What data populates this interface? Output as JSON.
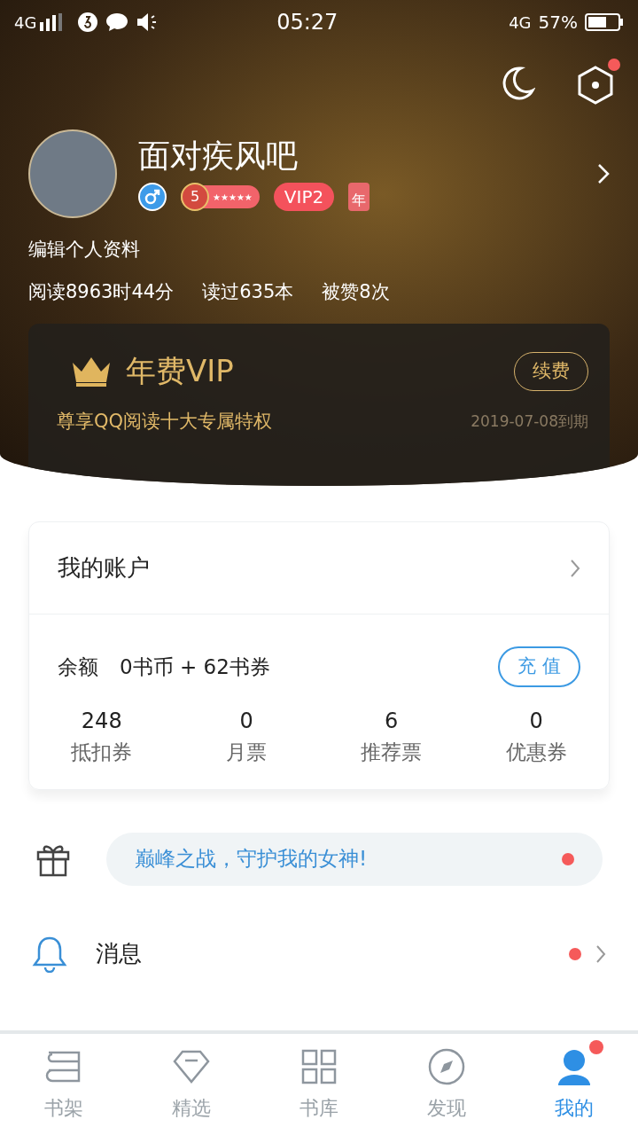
{
  "status_bar": {
    "network": "4G",
    "time": "05:27",
    "network_right": "4G",
    "battery": "57%"
  },
  "header": {
    "settings_badge": true
  },
  "profile": {
    "name": "面对疾风吧",
    "level": "5",
    "level_stars": "★★★★★",
    "vip": "VIP2",
    "year_badge": "年",
    "edit": "编辑个人资料",
    "stats": [
      "阅读8963时44分",
      "读过635本",
      "被赞8次"
    ]
  },
  "vip_card": {
    "title": "年费VIP",
    "renew": "续费",
    "subtitle": "尊享QQ阅读十大专属特权",
    "expiry": "2019-07-08到期"
  },
  "account": {
    "title": "我的账户",
    "balance_label": "余额",
    "balance": "0书币 + 62书券",
    "recharge": "充 值",
    "items": [
      {
        "value": "248",
        "label": "抵扣券"
      },
      {
        "value": "0",
        "label": "月票"
      },
      {
        "value": "6",
        "label": "推荐票"
      },
      {
        "value": "0",
        "label": "优惠券"
      }
    ]
  },
  "promo": {
    "text": "巅峰之战，守护我的女神!",
    "unread": true
  },
  "messages": {
    "title": "消息",
    "unread": true
  },
  "tabs": [
    {
      "label": "书架",
      "kind": "shelf",
      "selected": false,
      "badge": false
    },
    {
      "label": "精选",
      "kind": "diamond",
      "selected": false,
      "badge": false
    },
    {
      "label": "书库",
      "kind": "grid",
      "selected": false,
      "badge": false
    },
    {
      "label": "发现",
      "kind": "compass",
      "selected": false,
      "badge": false
    },
    {
      "label": "我的",
      "kind": "person",
      "selected": true,
      "badge": true
    }
  ]
}
